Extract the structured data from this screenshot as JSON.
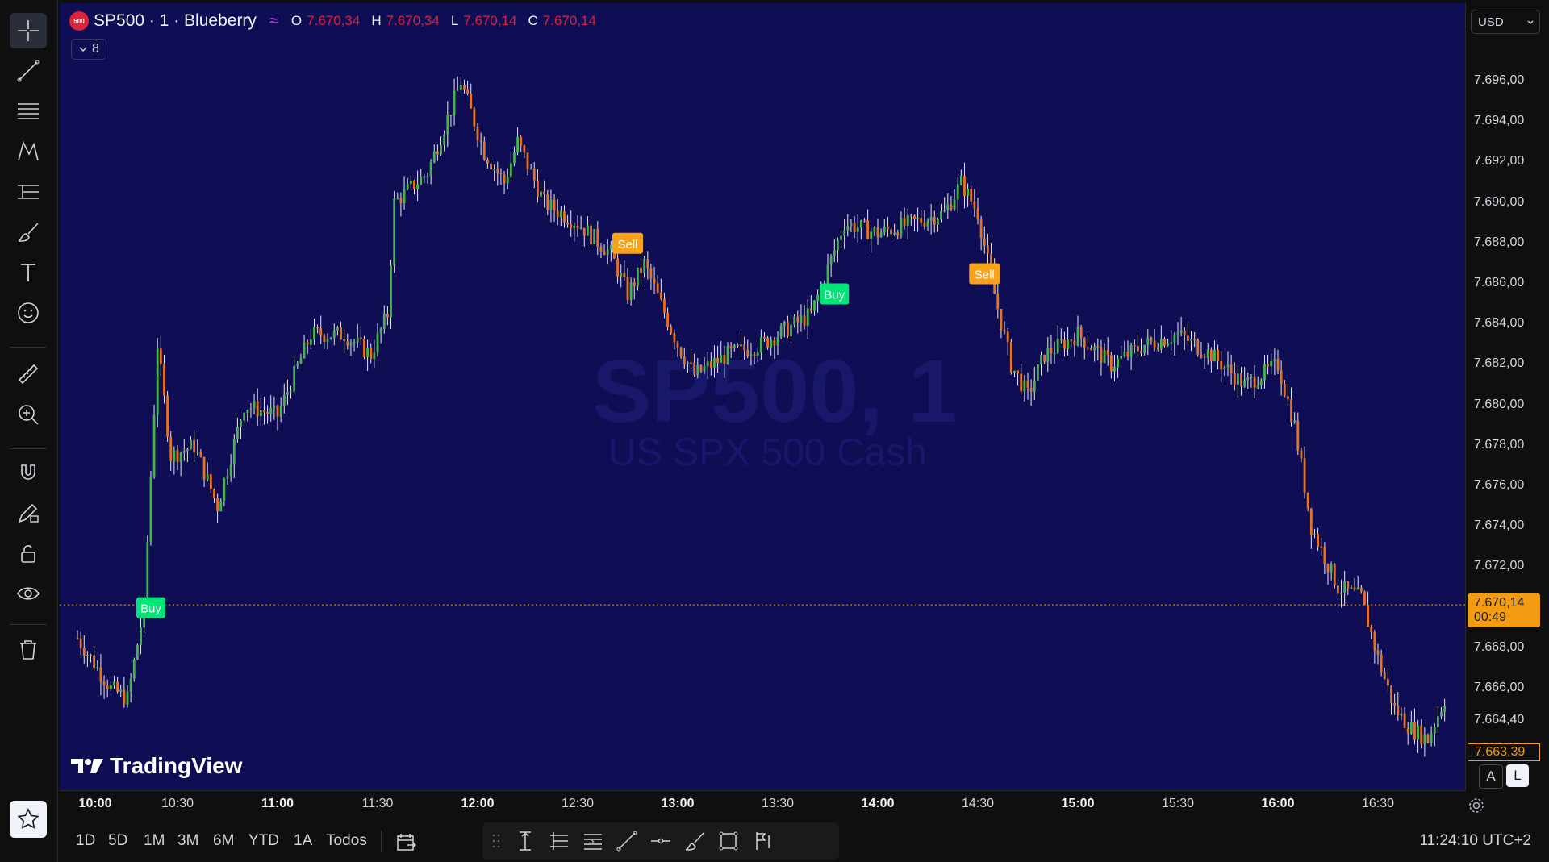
{
  "symbol": {
    "badge": "500",
    "title": "SP500 · 1 · Blueberry",
    "ohlc": [
      {
        "key": "O",
        "value": "7.670,34"
      },
      {
        "key": "H",
        "value": "7.670,34"
      },
      {
        "key": "L",
        "value": "7.670,14"
      },
      {
        "key": "C",
        "value": "7.670,14"
      }
    ],
    "indicator_count": "8"
  },
  "watermark": {
    "line1": "SP500, 1",
    "line2": "US SPX 500 Cash"
  },
  "logo": {
    "text": "TradingView"
  },
  "price_axis": {
    "currency": "USD",
    "last_price": "7.670,14",
    "countdown": "00:49",
    "cursor_price": "7.663,39",
    "ticks": [
      "7.696,00",
      "7.694,00",
      "7.692,00",
      "7.690,00",
      "7.688,00",
      "7.686,00",
      "7.684,00",
      "7.682,00",
      "7.680,00",
      "7.678,00",
      "7.676,00",
      "7.674,00",
      "7.672,00",
      "7.668,00",
      "7.666,00",
      "7.664,40"
    ],
    "auto_label": "A",
    "log_label": "L"
  },
  "time_axis": {
    "ticks": [
      {
        "label": "10:00",
        "bold": true
      },
      {
        "label": "10:30",
        "bold": false
      },
      {
        "label": "11:00",
        "bold": true
      },
      {
        "label": "11:30",
        "bold": false
      },
      {
        "label": "12:00",
        "bold": true
      },
      {
        "label": "12:30",
        "bold": false
      },
      {
        "label": "13:00",
        "bold": true
      },
      {
        "label": "13:30",
        "bold": false
      },
      {
        "label": "14:00",
        "bold": true
      },
      {
        "label": "14:30",
        "bold": false
      },
      {
        "label": "15:00",
        "bold": true
      },
      {
        "label": "15:30",
        "bold": false
      },
      {
        "label": "16:00",
        "bold": true
      },
      {
        "label": "16:30",
        "bold": false
      }
    ]
  },
  "bottom_bar": {
    "ranges": [
      "1D",
      "5D",
      "1M",
      "3M",
      "6M",
      "YTD",
      "1A",
      "Todos"
    ],
    "clock": "11:24:10 UTC+2"
  },
  "signals": [
    {
      "label": "Buy",
      "kind": "buy"
    },
    {
      "label": "Sell",
      "kind": "sell"
    },
    {
      "label": "Buy",
      "kind": "buy"
    },
    {
      "label": "Sell",
      "kind": "sell"
    }
  ],
  "colors": {
    "background": "#0f0d54",
    "bull": "#43b649",
    "bear": "#e8731c",
    "buy_signal": "#00e676",
    "sell_signal": "#f7a21a",
    "last_price": "#f39c12"
  },
  "chart_data": {
    "type": "candlestick",
    "x_range": [
      "10:00",
      "16:50"
    ],
    "y_range": [
      7662.0,
      7700.0
    ],
    "last_price": 7670.14,
    "price_path": [
      {
        "time": "10:00",
        "price": 7668.5
      },
      {
        "time": "10:10",
        "price": 7666.0
      },
      {
        "time": "10:15",
        "price": 7665.5
      },
      {
        "time": "10:20",
        "price": 7670.0
      },
      {
        "time": "10:24",
        "price": 7683.0
      },
      {
        "time": "10:28",
        "price": 7677.5
      },
      {
        "time": "10:35",
        "price": 7678.0
      },
      {
        "time": "10:42",
        "price": 7675.0
      },
      {
        "time": "10:50",
        "price": 7680.0
      },
      {
        "time": "11:00",
        "price": 7679.5
      },
      {
        "time": "11:10",
        "price": 7683.5
      },
      {
        "time": "11:20",
        "price": 7683.5
      },
      {
        "time": "11:28",
        "price": 7682.5
      },
      {
        "time": "11:33",
        "price": 7684.5
      },
      {
        "time": "11:35",
        "price": 7690.0
      },
      {
        "time": "11:45",
        "price": 7691.5
      },
      {
        "time": "11:55",
        "price": 7696.0
      },
      {
        "time": "12:02",
        "price": 7692.5
      },
      {
        "time": "12:08",
        "price": 7691.0
      },
      {
        "time": "12:12",
        "price": 7693.0
      },
      {
        "time": "12:20",
        "price": 7690.0
      },
      {
        "time": "12:30",
        "price": 7689.0
      },
      {
        "time": "12:40",
        "price": 7687.5
      },
      {
        "time": "12:45",
        "price": 7685.5
      },
      {
        "time": "12:50",
        "price": 7687.0
      },
      {
        "time": "13:00",
        "price": 7683.0
      },
      {
        "time": "13:05",
        "price": 7681.5
      },
      {
        "time": "13:15",
        "price": 7682.5
      },
      {
        "time": "13:25",
        "price": 7683.0
      },
      {
        "time": "13:40",
        "price": 7684.5
      },
      {
        "time": "13:50",
        "price": 7689.0
      },
      {
        "time": "14:00",
        "price": 7688.5
      },
      {
        "time": "14:10",
        "price": 7689.0
      },
      {
        "time": "14:20",
        "price": 7689.5
      },
      {
        "time": "14:25",
        "price": 7691.0
      },
      {
        "time": "14:30",
        "price": 7689.5
      },
      {
        "time": "14:35",
        "price": 7685.5
      },
      {
        "time": "14:40",
        "price": 7682.0
      },
      {
        "time": "14:45",
        "price": 7680.5
      },
      {
        "time": "14:50",
        "price": 7682.5
      },
      {
        "time": "15:00",
        "price": 7683.5
      },
      {
        "time": "15:10",
        "price": 7682.0
      },
      {
        "time": "15:20",
        "price": 7683.0
      },
      {
        "time": "15:30",
        "price": 7683.5
      },
      {
        "time": "15:40",
        "price": 7682.5
      },
      {
        "time": "15:50",
        "price": 7681.0
      },
      {
        "time": "16:00",
        "price": 7682.0
      },
      {
        "time": "16:05",
        "price": 7679.0
      },
      {
        "time": "16:10",
        "price": 7674.0
      },
      {
        "time": "16:18",
        "price": 7671.0
      },
      {
        "time": "16:25",
        "price": 7670.5
      },
      {
        "time": "16:30",
        "price": 7667.5
      },
      {
        "time": "16:35",
        "price": 7665.0
      },
      {
        "time": "16:40",
        "price": 7664.0
      },
      {
        "time": "16:45",
        "price": 7663.5
      },
      {
        "time": "16:50",
        "price": 7665.5
      }
    ],
    "signals": [
      {
        "time": "10:22",
        "price": 7670.0,
        "label": "Buy"
      },
      {
        "time": "12:45",
        "price": 7688.0,
        "label": "Sell"
      },
      {
        "time": "13:47",
        "price": 7685.5,
        "label": "Buy"
      },
      {
        "time": "14:32",
        "price": 7686.5,
        "label": "Sell"
      }
    ]
  }
}
